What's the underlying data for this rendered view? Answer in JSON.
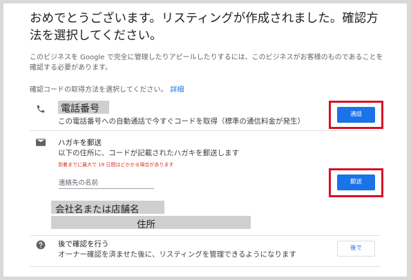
{
  "header": {
    "title": "おめでとうございます。リスティングが作成されました。確認方法を選択してください。",
    "description": "このビジネスを Google で完全に管理したりアピールしたりするには、このビジネスがお客様のものであることを確認する必要があります。",
    "method_prompt": "確認コードの取得方法を選択してください。",
    "detail_link": "詳細"
  },
  "phone": {
    "title": "電話番号",
    "subtitle": "この電話番号への自動通話で今すぐコードを取得（標準の通信料金が発生）",
    "button": "通話",
    "icon": "phone-icon"
  },
  "mail": {
    "title": "ハガキを郵送",
    "subtitle": "以下の住所に、コードが記載されたハガキを郵送します",
    "note": "到着までに最大で 19 日間ほどかかる場合があります",
    "contact_placeholder": "連絡先の名前",
    "company_label": "会社名または店舗名",
    "address_label": "住所",
    "button": "郵送",
    "icon": "mail-icon"
  },
  "later": {
    "title": "後で確認を行う",
    "subtitle": "オーナー確認を済ませた後に、リスティングを管理できるようになります",
    "button": "後で",
    "icon": "help-icon"
  },
  "colors": {
    "accent": "#1a73e8",
    "highlight_frame": "#d50f25",
    "note_red": "#d93025"
  }
}
